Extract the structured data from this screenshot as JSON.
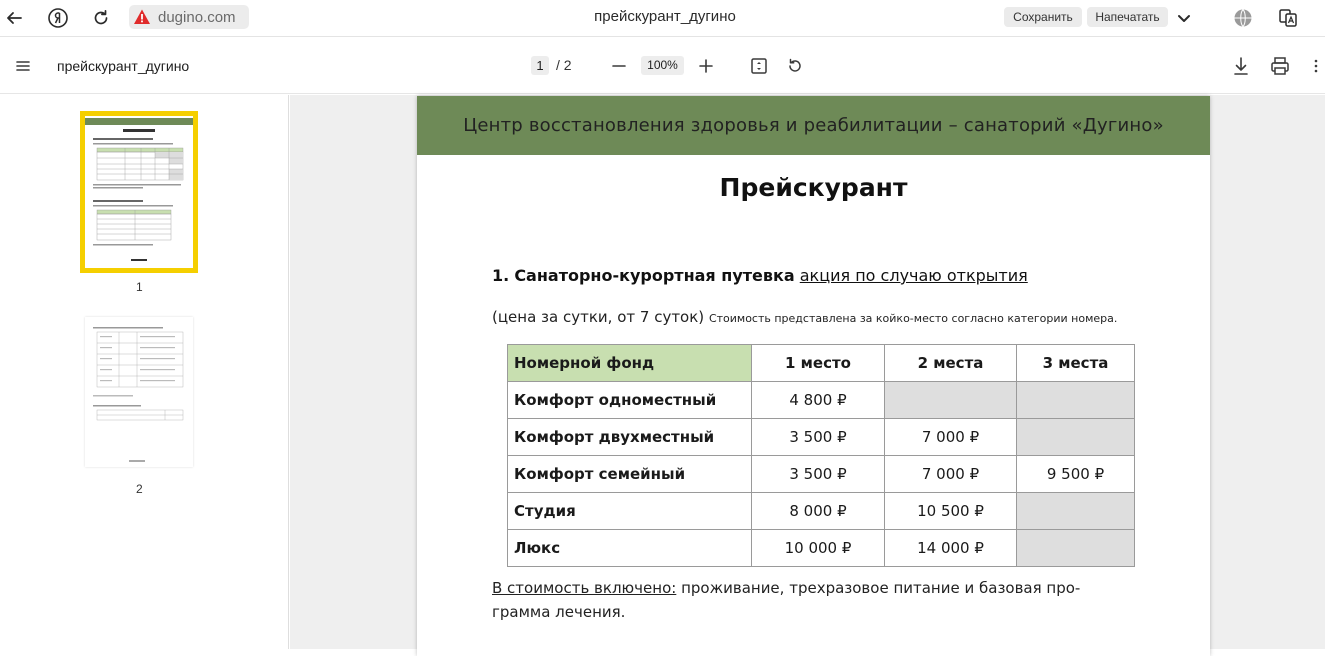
{
  "browser": {
    "url": "dugino.com",
    "title": "прейскурант_дугино",
    "save_label": "Сохранить",
    "print_label": "Напечатать"
  },
  "viewer": {
    "doc_name": "прейскурант_дугино",
    "current_page": "1",
    "page_total": "/  2",
    "zoom": "100%"
  },
  "thumbnails": [
    {
      "label": "1",
      "selected": true
    },
    {
      "label": "2",
      "selected": false
    }
  ],
  "document": {
    "header": "Центр восстановления здоровья и реабилитации – санаторий «Дугино»",
    "title": "Прейскурант",
    "section": {
      "number": "1.",
      "title": "Санаторно-курортная путевка",
      "promo": "акция по случаю открытия"
    },
    "price_note": "(цена за сутки, от 7 суток)",
    "price_note_small": "Стоимость представлена за койко-место согласно категории номера.",
    "table": {
      "headers": [
        "Номерной фонд",
        "1 место",
        "2 места",
        "3 места"
      ],
      "rows": [
        [
          "Комфорт одноместный",
          "4 800 ₽",
          "",
          ""
        ],
        [
          "Комфорт двухместный",
          "3 500 ₽",
          "7 000 ₽",
          ""
        ],
        [
          "Комфорт семейный",
          "3 500 ₽",
          "7 000 ₽",
          "9 500 ₽"
        ],
        [
          "Студия",
          "8 000 ₽",
          "10 500 ₽",
          ""
        ],
        [
          "Люкс",
          "10 000 ₽",
          "14 000 ₽",
          ""
        ]
      ]
    },
    "included_label": "В стоимость включено:",
    "included_text": " проживание, трехразовое питание и базовая про-грамма лечения."
  },
  "colors": {
    "header_green": "#6e8a57",
    "table_header_green": "#c8dfb0",
    "empty_cell": "#dedede",
    "thumb_selected": "#f5cf00"
  }
}
